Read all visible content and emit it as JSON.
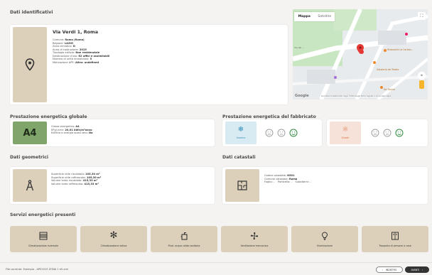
{
  "sections": {
    "identificativi": "Dati identificativi",
    "prestazione_globale": "Prestazione energetica globale",
    "prestazione_fabbricato": "Prestazione energetica del fabbricato",
    "geometrici": "Dati geometrici",
    "catastali": "Dati catastali",
    "servizi": "Servizi energetici presenti"
  },
  "building": {
    "title": "Via Verdi 1, Roma",
    "lines": [
      {
        "label": "Comune: ",
        "value": "Roma (Roma)"
      },
      {
        "label": "Regione: ",
        "value": "LAZIO"
      },
      {
        "label": "Zona climatica: ",
        "value": "D"
      },
      {
        "label": "Anno di costruzione: ",
        "value": "2015"
      },
      {
        "label": "Tipologia edilizia: ",
        "value": "Non residenziale"
      },
      {
        "label": "Destinazione d'uso: ",
        "value": "E2 uffici e assimilabili"
      },
      {
        "label": "Numero di unità immobiliari: ",
        "value": "5"
      },
      {
        "label": "Motivazione APE: ",
        "value": "Altro: undefined"
      }
    ]
  },
  "map": {
    "tab_map": "Mappa",
    "tab_sat": "Satellite",
    "google": "Google",
    "attrib": "Scorciatoie da tastiera  Dati mappa ©2024 Google  Termini  Segnala un errore nella mappa",
    "place1": "Ristorante La Carbon...",
    "place2": "Gelateria del Teatro",
    "place3": "Da Tonino",
    "street": "Via del ..."
  },
  "globale": {
    "badge": "A4",
    "classe": {
      "label": "Classe energetica: ",
      "value": "A4"
    },
    "ep": {
      "label": "EPgl,nren: ",
      "value": "20,01 kWh/m²anno"
    },
    "nzeb": {
      "label": "Edificio a energia quasi zero: ",
      "value": "No"
    }
  },
  "fabbricato": {
    "inverno": "Inverno",
    "estate": "Estate"
  },
  "geometrici": [
    {
      "label": "Superficie utile riscaldata: ",
      "value": "105,30 m²"
    },
    {
      "label": "Superficie utile raffrescata: ",
      "value": "105,30 m²"
    },
    {
      "label": "Volume lordo riscaldato: ",
      "value": "415,33 m³"
    },
    {
      "label": "Volume lordo raffrescato: ",
      "value": "415,33 m³"
    }
  ],
  "catastali": {
    "codice": {
      "label": "Codice catastale: ",
      "value": "H501"
    },
    "comune": {
      "label": "Comune catastale: ",
      "value": "Roma"
    },
    "line3": "Foglio: -    Particella: -    Subalterni: -"
  },
  "servizi": [
    "Climatizzazione invernale",
    "Climatizzazione estiva",
    "Prod. acqua calda sanitaria",
    "Ventilazione meccanica",
    "Illuminazione",
    "Trasporto di persone o cose"
  ],
  "footer": {
    "file": "File corrente: Esempio - APE2015 ZONA 1 e5.xml",
    "back": "INDIETRO",
    "next": "AVANTI"
  },
  "colors": {
    "accent": "#7fa56b",
    "tan": "#ddd0bb",
    "winter": "#d8eaf2",
    "summer": "#f6e2d8"
  }
}
